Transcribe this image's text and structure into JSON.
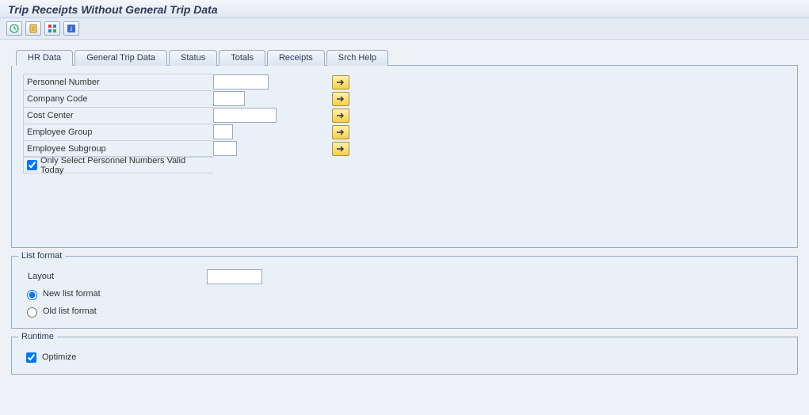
{
  "header": {
    "title": "Trip Receipts Without General Trip Data"
  },
  "toolbar": {
    "execute": "Execute",
    "variants": "Variants",
    "select": "Select",
    "info": "Information"
  },
  "tabs": [
    {
      "label": "HR Data",
      "active": true
    },
    {
      "label": "General Trip Data",
      "active": false
    },
    {
      "label": "Status",
      "active": false
    },
    {
      "label": "Totals",
      "active": false
    },
    {
      "label": "Receipts",
      "active": false
    },
    {
      "label": "Srch Help",
      "active": false
    }
  ],
  "hrdata": {
    "personnel_number": {
      "label": "Personnel Number",
      "value": ""
    },
    "company_code": {
      "label": "Company Code",
      "value": ""
    },
    "cost_center": {
      "label": "Cost Center",
      "value": ""
    },
    "employee_group": {
      "label": "Employee Group",
      "value": ""
    },
    "employee_subgroup": {
      "label": "Employee Subgroup",
      "value": ""
    },
    "valid_today": {
      "label": "Only Select Personnel Numbers Valid Today",
      "checked": true
    }
  },
  "list_format": {
    "title": "List format",
    "layout_label": "Layout",
    "layout_value": "",
    "new_label": "New list format",
    "old_label": "Old list format",
    "selected": "new"
  },
  "runtime": {
    "title": "Runtime",
    "optimize_label": "Optimize",
    "optimize_checked": true
  }
}
